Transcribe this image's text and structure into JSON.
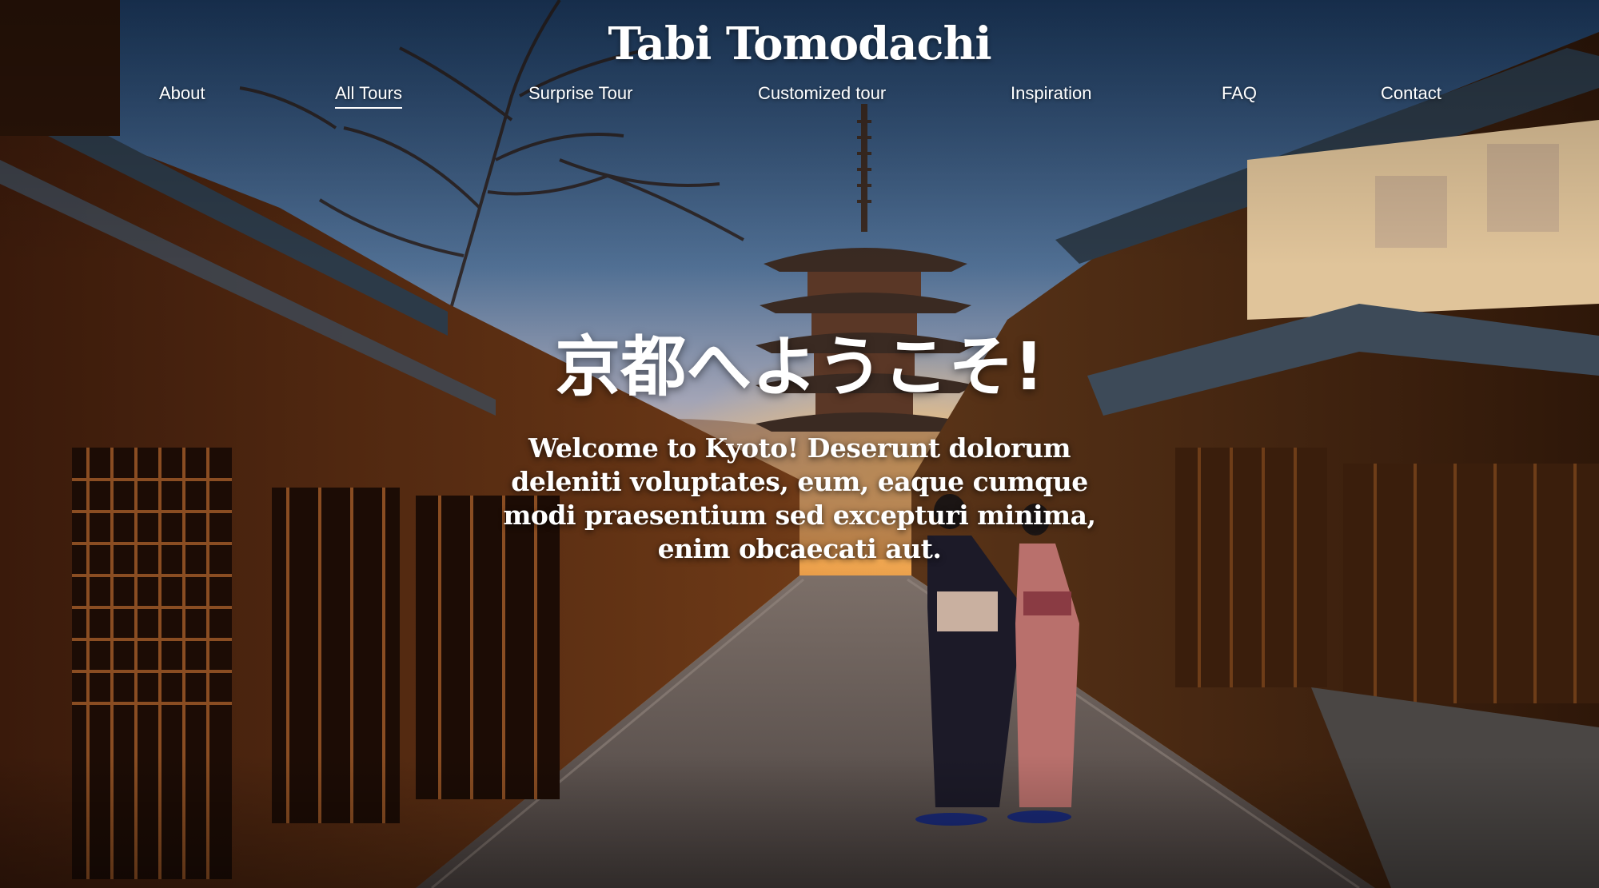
{
  "site": {
    "title": "Tabi Tomodachi"
  },
  "nav": {
    "items": [
      {
        "label": "About"
      },
      {
        "label": "All Tours"
      },
      {
        "label": "Surprise Tour"
      },
      {
        "label": "Customized tour"
      },
      {
        "label": "Inspiration"
      },
      {
        "label": "FAQ"
      },
      {
        "label": "Contact"
      }
    ],
    "active": "All Tours"
  },
  "hero": {
    "heading": "京都へようこそ!",
    "text": "Welcome to Kyoto! Deserunt dolorum deleniti voluptates, eum, eaque cumque modi praesentium sed excepturi minima, enim obcaecati aut."
  },
  "colors": {
    "text": "#ffffff"
  }
}
